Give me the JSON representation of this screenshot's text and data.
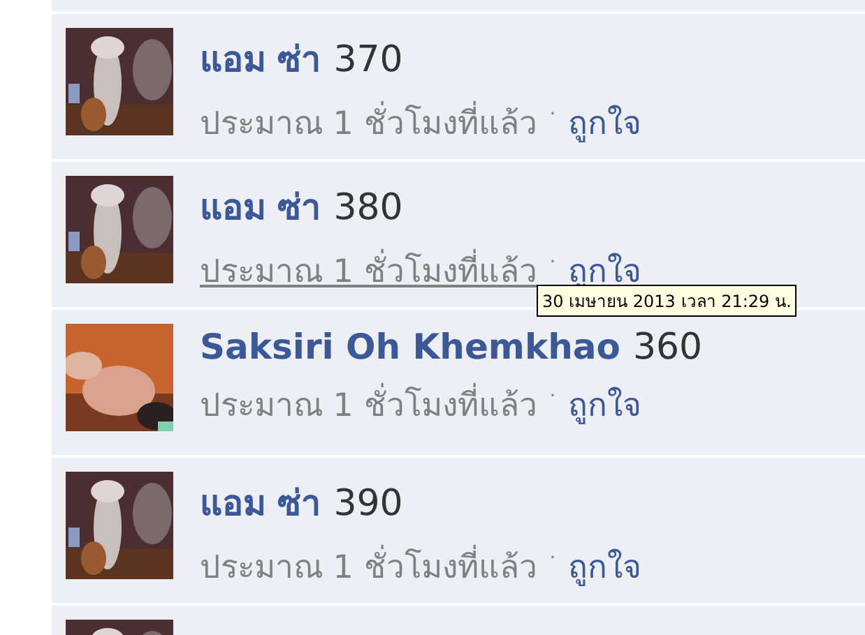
{
  "comments": [
    {
      "kind": "statue",
      "author": "แอม ซ่า",
      "text": "370",
      "time": "ประมาณ 1 ชั่วโมงที่แล้ว",
      "time_hovered": false,
      "separator": "·",
      "like": "ถูกใจ"
    },
    {
      "kind": "statue",
      "author": "แอม ซ่า",
      "text": "380",
      "time": "ประมาณ 1 ชั่วโมงที่แล้ว",
      "time_hovered": true,
      "separator": "·",
      "like": "ถูกใจ"
    },
    {
      "kind": "portrait",
      "author": "Saksiri Oh Khemkhao",
      "text": "360",
      "time": "ประมาณ 1 ชั่วโมงที่แล้ว",
      "time_hovered": false,
      "separator": "·",
      "like": "ถูกใจ"
    },
    {
      "kind": "statue",
      "author": "แอม ซ่า",
      "text": "390",
      "time": "ประมาณ 1 ชั่วโมงที่แล้ว",
      "time_hovered": false,
      "separator": "·",
      "like": "ถูกใจ"
    }
  ],
  "tooltip": {
    "text": "30 เมษายน 2013 เวลา 21:29 น."
  }
}
